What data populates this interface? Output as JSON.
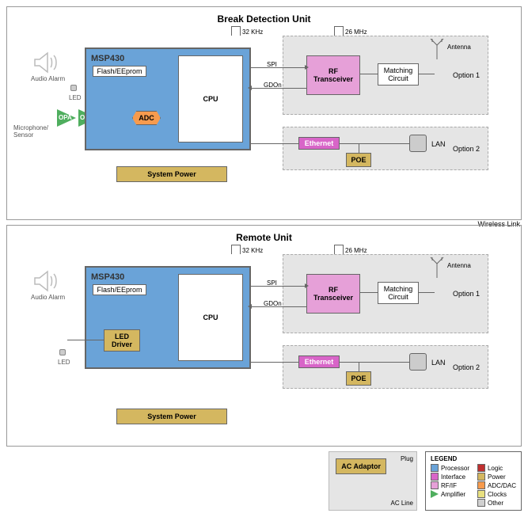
{
  "units": {
    "break": {
      "title": "Break Detection Unit"
    },
    "remote": {
      "title": "Remote Unit"
    }
  },
  "blocks": {
    "msp": "MSP430",
    "flash": "Flash/EEprom",
    "cpu": "CPU",
    "adc": "ADC",
    "opa": "OPA",
    "sys_power": "System Power",
    "led_driver": "LED Driver",
    "rf": "RF Transceiver",
    "matching": "Matching Circuit",
    "ethernet": "Ethernet",
    "poe": "POE",
    "lan": "LAN",
    "ac_adaptor": "AC Adaptor"
  },
  "labels": {
    "audio_alarm": "Audio Alarm",
    "mic_sensor": "Microphone/ Sensor",
    "led": "LED",
    "antenna": "Antenna",
    "option1": "Option 1",
    "option2": "Option 2",
    "spi": "SPI",
    "gdon": "GDOn",
    "wireless": "Wireless Link",
    "plug": "Plug",
    "ac_line": "AC Line"
  },
  "clocks": {
    "k32": "32 KHz",
    "m26": "26 MHz"
  },
  "legend": {
    "title": "LEGEND",
    "items": [
      {
        "swatch": "#6aa3d8",
        "label": "Processor"
      },
      {
        "swatch": "#c03030",
        "label": "Logic"
      },
      {
        "swatch": "#d865c8",
        "label": "Interface"
      },
      {
        "swatch": "#d4b760",
        "label": "Power"
      },
      {
        "swatch": "#e6a0d8",
        "label": "RF/IF"
      },
      {
        "swatch": "#f79b4e",
        "label": "ADC/DAC"
      },
      {
        "swatch": "tri",
        "label": "Amplifier"
      },
      {
        "swatch": "#e8e080",
        "label": "Clocks"
      },
      {
        "swatch": "",
        "label": ""
      },
      {
        "swatch": "#d0d0d0",
        "label": "Other"
      }
    ]
  }
}
